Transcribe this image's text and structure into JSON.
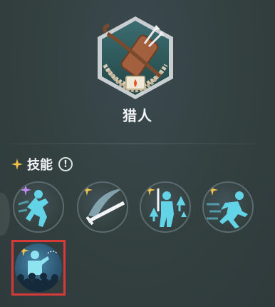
{
  "class": {
    "name": "猎人",
    "emblem_icon": "bow-and-quiver-emblem"
  },
  "skills_section": {
    "label": "技能",
    "info_icon_text": "!"
  },
  "skills": [
    {
      "icon": "ninja-throwing-star-skill-icon",
      "sparkle_color": "#c58cf5"
    },
    {
      "icon": "sword-slash-skill-icon",
      "sparkle_color": "#f3c24e"
    },
    {
      "icon": "attack-up-buff-skill-icon",
      "sparkle_color": "#f3c24e"
    },
    {
      "icon": "dash-sprint-skill-icon",
      "sparkle_color": "#f3c24e"
    },
    {
      "icon": "crowd-command-skill-icon",
      "sparkle_color": "#f3c24e",
      "selected": true
    }
  ],
  "colors": {
    "skill_figure": "#63d3e8",
    "selection_border": "#d83a3a",
    "emblem_teal": "#2d5a5e"
  }
}
